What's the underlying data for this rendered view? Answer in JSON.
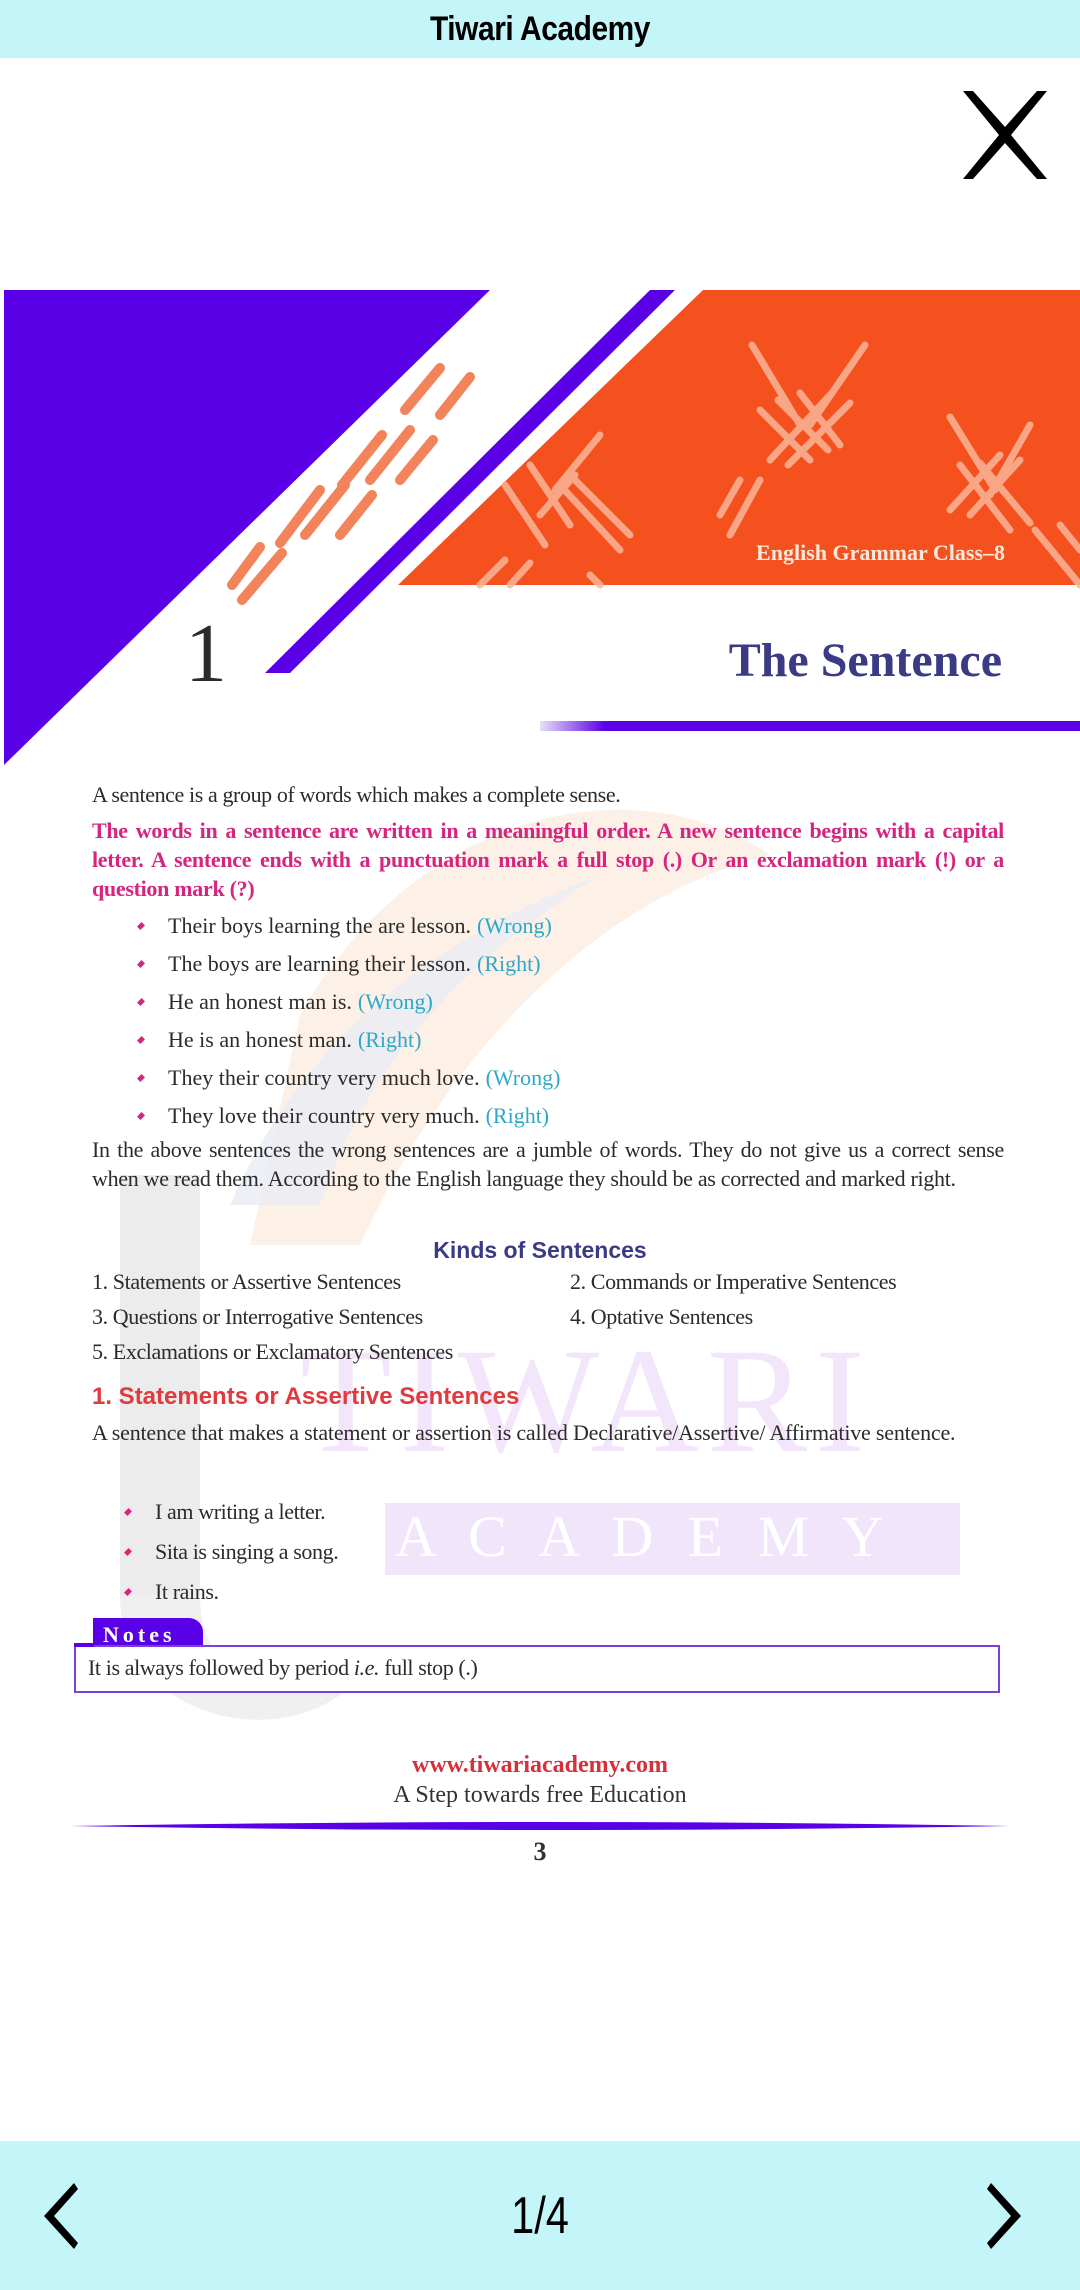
{
  "app": {
    "title": "Tiwari Academy"
  },
  "controls": {
    "close_icon": "close-icon",
    "prev_icon": "chevron-left-icon",
    "next_icon": "chevron-right-icon",
    "page_indicator": "1/4",
    "current_page": 1,
    "total_pages": 4
  },
  "colors": {
    "bar_bg": "#c4f6f9",
    "banner_purple": "#5a00e6",
    "banner_orange": "#f4511e",
    "title_navy": "#3b3a85",
    "rule_pink": "#d6257f",
    "tag_cyan": "#2ea8c7",
    "heading_red": "#e03a3e"
  },
  "document": {
    "banner_subtitle": "English Grammar Class–8",
    "chapter_number": "1",
    "chapter_title": "The Sentence",
    "intro": "A sentence is a group of words which makes a complete sense.",
    "rule": "The words in a sentence are written in a meaningful order. A new sentence begins with a capital letter. A sentence ends with a punctuation mark a full stop (.) Or an exclamation mark (!) or a question mark (?)",
    "examples": [
      {
        "text": "Their boys learning the are lesson.",
        "tag": "(Wrong)"
      },
      {
        "text": "The boys are learning their lesson.",
        "tag": "(Right)"
      },
      {
        "text": "He an honest man is.",
        "tag": "(Wrong)"
      },
      {
        "text": "He is an honest man.",
        "tag": "(Right)"
      },
      {
        "text": "They their country very much love.",
        "tag": "(Wrong)"
      },
      {
        "text": "They love their country very much.",
        "tag": "(Right)"
      }
    ],
    "explanation": "In the above sentences the wrong sentences are a jumble of words. They do not give us a correct sense when we read them. According to the English language they should be as corrected and marked right.",
    "kinds_title": "Kinds of Sentences",
    "kinds": [
      "1. Statements or Assertive Sentences",
      "2. Commands or Imperative Sentences",
      "3. Questions or Interrogative Sentences",
      "4. Optative Sentences",
      "5. Exclamations or Exclamatory Sentences"
    ],
    "section_title": "1. Statements or Assertive Sentences",
    "section_definition": "A sentence that makes a statement or assertion is called Declarative/Assertive/ Affirmative sentence.",
    "section_examples": [
      "I am writing a letter.",
      "Sita is singing a song.",
      "It rains."
    ],
    "notes_label": "Notes",
    "notes_text_before": "It is always followed by period ",
    "notes_text_italic": "i.e.",
    "notes_text_after": " full stop (.)",
    "footer_url": "www.tiwariacademy.com",
    "footer_tagline": "A Step towards free Education",
    "page_number": "3",
    "watermark_word1": "TIWARI",
    "watermark_word2": "A C A D E M Y"
  }
}
